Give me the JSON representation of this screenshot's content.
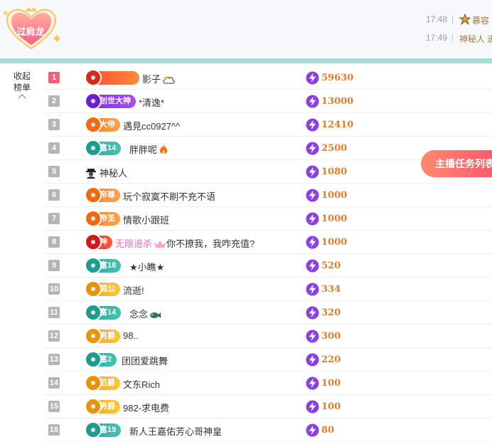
{
  "header": {
    "badge_label": "过肩龙",
    "chat": [
      {
        "time": "17:48",
        "name": "慕容"
      },
      {
        "time": "17:49",
        "name": "神秘人 进"
      }
    ]
  },
  "sidebar": {
    "collapse_label_1": "收起",
    "collapse_label_2": "榜单"
  },
  "task_button_label": "主播任务列表",
  "colors": {
    "score": "#e27c2e",
    "rank_first": "#f2607a",
    "teal": "#a8ddd7",
    "task_button": "#ff6a6c"
  },
  "ranking": [
    {
      "rank": "1",
      "tag": "",
      "tag_style": "rocket",
      "name": "影子",
      "score": "59630"
    },
    {
      "rank": "2",
      "tag": "创世大神",
      "tag_style": "purple",
      "name": "*清逸*",
      "score": "13000"
    },
    {
      "rank": "3",
      "tag": "大帝",
      "tag_style": "orange",
      "name": "遇見cc0927^^",
      "score": "12410"
    },
    {
      "rank": "4",
      "tag": "富14",
      "tag_style": "teal",
      "name": "胖胖呢",
      "score": "2500"
    },
    {
      "rank": "5",
      "tag": "",
      "tag_style": "none",
      "name": "神秘人",
      "score": "1080"
    },
    {
      "rank": "6",
      "tag": "帝尊",
      "tag_style": "orange",
      "name": "玩个寂寞不刷不充不语",
      "score": "1000"
    },
    {
      "rank": "7",
      "tag": "帝圣",
      "tag_style": "orange",
      "name": "情歌小跟班",
      "score": "1000"
    },
    {
      "rank": "8",
      "tag": "神",
      "tag_style": "red",
      "name_prefix": "无限追杀",
      "name": "你不撩我，我咋充值?",
      "score": "1000"
    },
    {
      "rank": "9",
      "tag": "富18",
      "tag_style": "teal",
      "name": "★小瞧★",
      "score": "520"
    },
    {
      "rank": "10",
      "tag": "国公",
      "tag_style": "gold",
      "name": "流逝!",
      "score": "334"
    },
    {
      "rank": "11",
      "tag": "富14",
      "tag_style": "teal",
      "name": "念念",
      "score": "320"
    },
    {
      "rank": "12",
      "tag": "男爵",
      "tag_style": "gold",
      "name": "98..",
      "score": "300"
    },
    {
      "rank": "13",
      "tag": "富2",
      "tag_style": "teal",
      "name": "团团爱跳舞",
      "score": "220"
    },
    {
      "rank": "14",
      "tag": "伯爵",
      "tag_style": "gold",
      "name": "文东Rich",
      "score": "100"
    },
    {
      "rank": "15",
      "tag": "男爵",
      "tag_style": "gold",
      "name": "982-求电费",
      "score": "100"
    },
    {
      "rank": "16",
      "tag": "富19",
      "tag_style": "teal",
      "name": "新人王嘉佑芳心哥神皇",
      "score": "80"
    }
  ]
}
